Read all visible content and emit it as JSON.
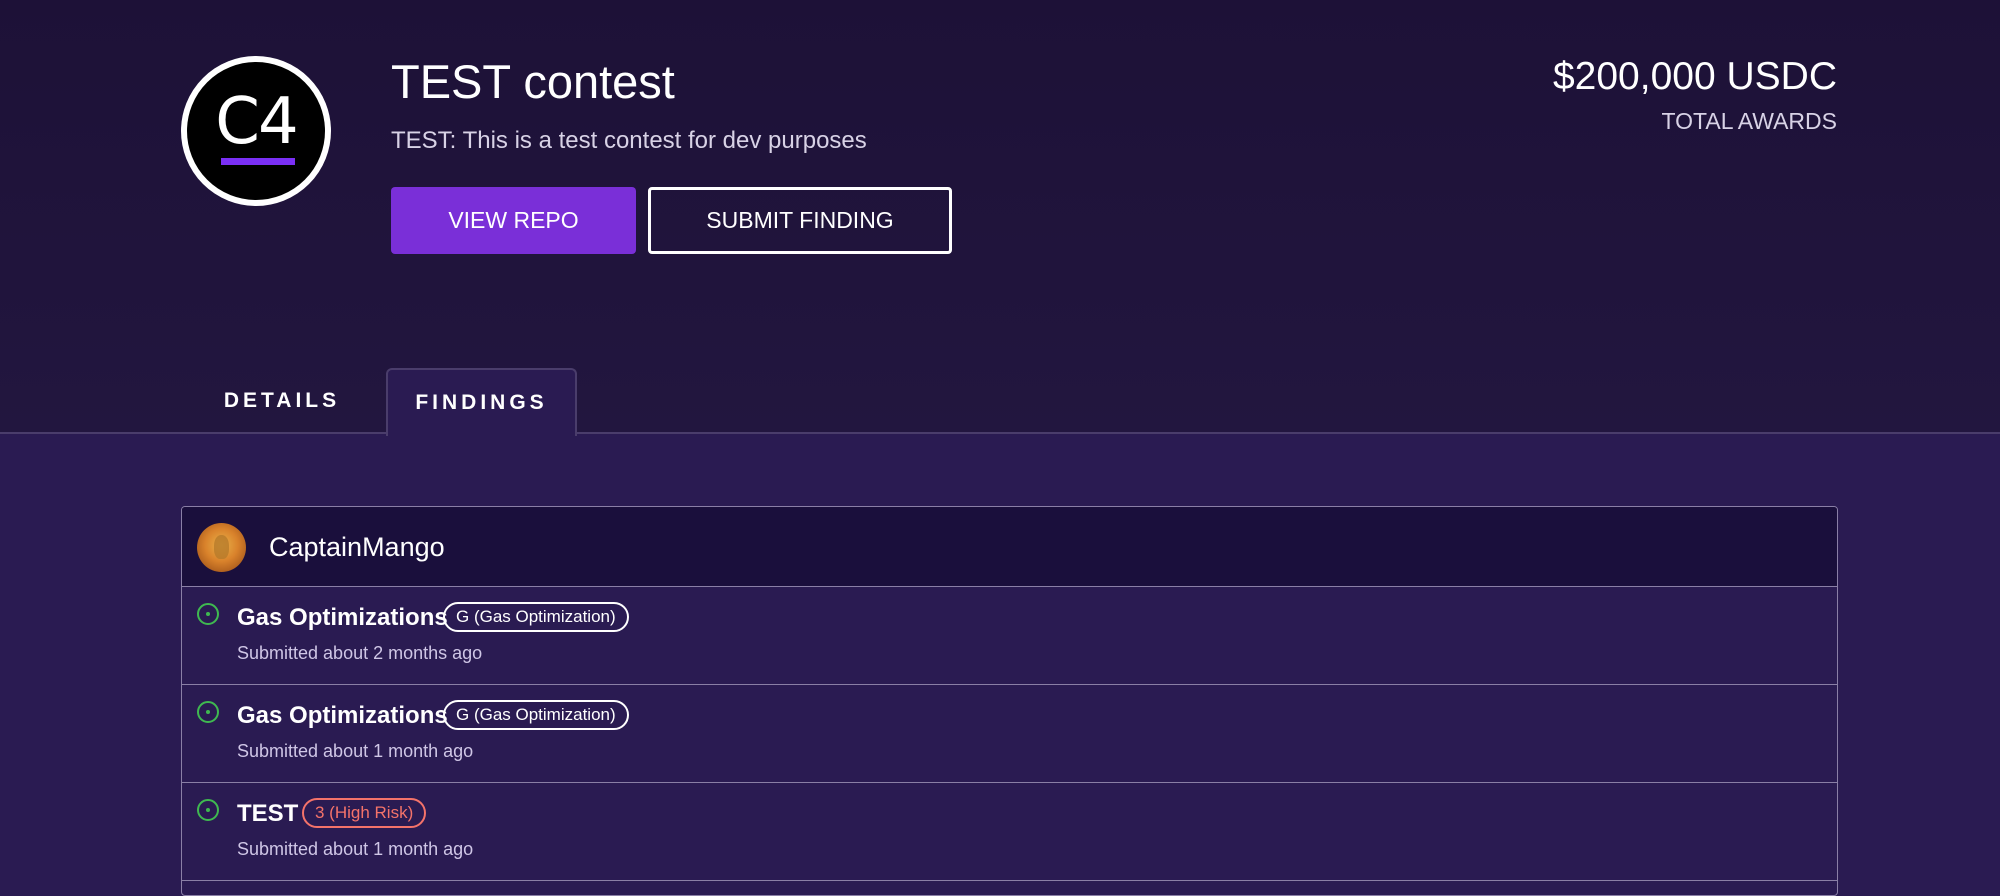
{
  "contest": {
    "logo_text": "C4",
    "title": "TEST contest",
    "description": "TEST: This is a test contest for dev purposes",
    "view_repo_label": "VIEW REPO",
    "submit_finding_label": "SUBMIT FINDING",
    "awards_amount": "$200,000 USDC",
    "awards_label": "TOTAL AWARDS"
  },
  "tabs": [
    {
      "label": "DETAILS",
      "active": false
    },
    {
      "label": "FINDINGS",
      "active": true
    }
  ],
  "findings_group": {
    "username": "CaptainMango",
    "items": [
      {
        "title": "Gas Optimizations",
        "badge": "G (Gas Optimization)",
        "badge_type": "gas",
        "submitted": "Submitted about 2 months ago",
        "status": "open"
      },
      {
        "title": "Gas Optimizations",
        "badge": "G (Gas Optimization)",
        "badge_type": "gas",
        "submitted": "Submitted about 1 month ago",
        "status": "open"
      },
      {
        "title": "TEST",
        "badge": "3 (High Risk)",
        "badge_type": "high",
        "submitted": "Submitted about 1 month ago",
        "status": "open"
      }
    ]
  },
  "colors": {
    "accent": "#7a2fd8",
    "status_open": "#3fb950",
    "high_risk": "#f4736a",
    "background": "#2a1b52"
  },
  "icons": {
    "status": "circle-dot-icon",
    "avatar": "user-avatar"
  }
}
